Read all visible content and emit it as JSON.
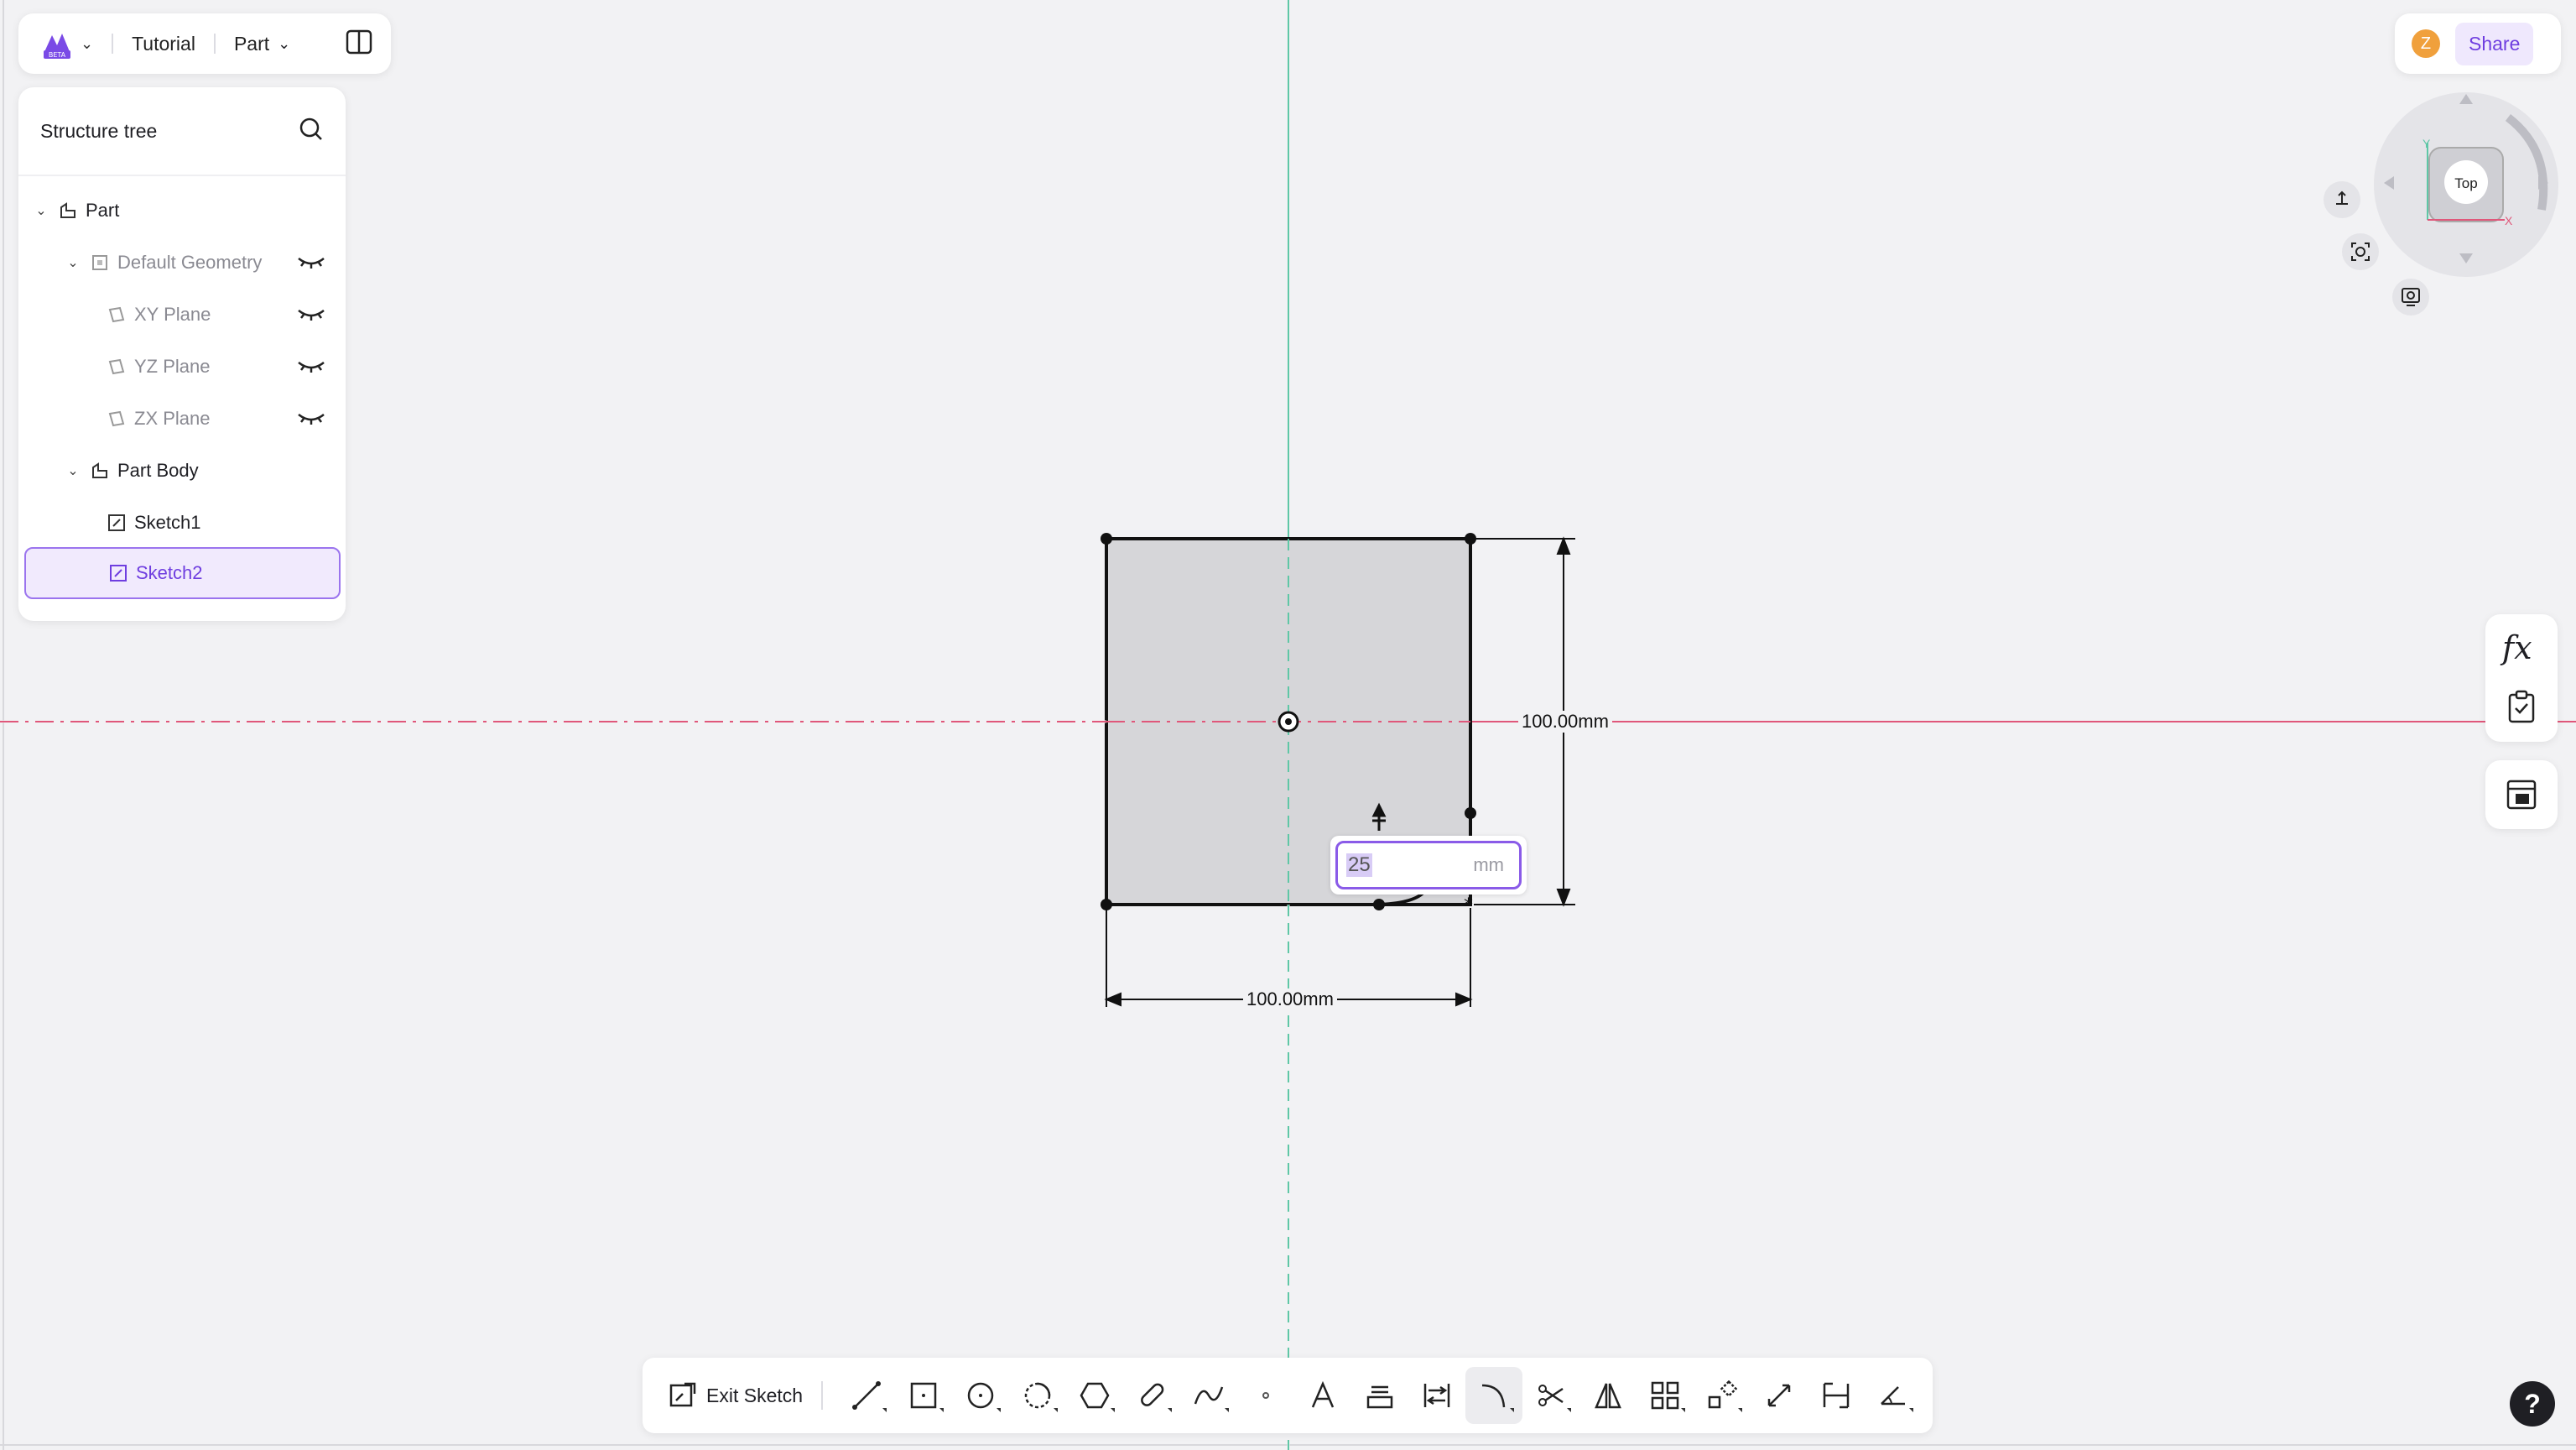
{
  "header": {
    "project": "Tutorial",
    "mode": "Part",
    "logo_badge": "BETA"
  },
  "tree": {
    "title": "Structure tree",
    "items": [
      {
        "label": "Part",
        "level": 0,
        "expanded": true
      },
      {
        "label": "Default Geometry",
        "level": 1,
        "expanded": true,
        "hidden": true
      },
      {
        "label": "XY Plane",
        "level": 2,
        "hidden": true
      },
      {
        "label": "YZ Plane",
        "level": 2,
        "hidden": true
      },
      {
        "label": "ZX Plane",
        "level": 2,
        "hidden": true
      },
      {
        "label": "Part Body",
        "level": 1,
        "expanded": true
      },
      {
        "label": "Sketch1",
        "level": 2
      },
      {
        "label": "Sketch2",
        "level": 2,
        "selected": true
      }
    ]
  },
  "topright": {
    "avatar_initial": "Z",
    "share_label": "Share"
  },
  "viewcube": {
    "face": "Top",
    "axis_y": "Y",
    "axis_x": "X"
  },
  "canvas": {
    "dim_horizontal": "100.00mm",
    "dim_vertical": "100.00mm",
    "input_value": "25",
    "input_unit": "mm"
  },
  "toolbar": {
    "exit_label": "Exit Sketch",
    "tools": [
      "line-tool",
      "rectangle-tool",
      "circle-tool",
      "arc-tool",
      "polygon-tool",
      "slot-tool",
      "spline-tool",
      "point-tool",
      "text-tool",
      "project-tool",
      "offset-tool",
      "fillet-tool",
      "trim-tool",
      "mirror-tool",
      "pattern-tool",
      "transform-tool",
      "dimension-tool",
      "distance-constraint-tool",
      "angle-tool"
    ],
    "active_tool": "fillet-tool"
  },
  "help_label": "?",
  "colors": {
    "accent": "#7a4ae6",
    "x_axis": "#e0577a",
    "y_axis": "#5fc7a6",
    "avatar": "#f0a03c"
  }
}
